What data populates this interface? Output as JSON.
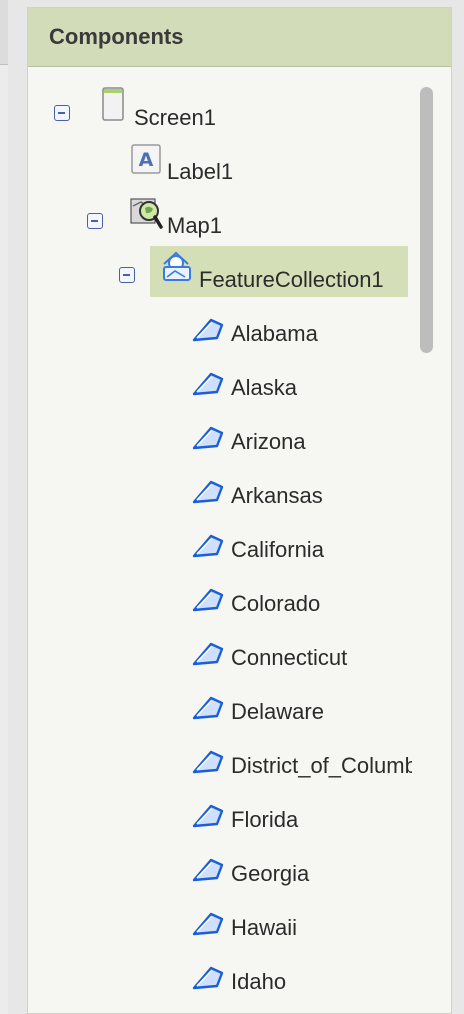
{
  "panel": {
    "title": "Components"
  },
  "tree": {
    "screen": {
      "label": "Screen1",
      "icon": "screen-icon"
    },
    "label_component": {
      "label": "Label1",
      "icon": "label-icon"
    },
    "map": {
      "label": "Map1",
      "icon": "map-icon"
    },
    "feature_collection": {
      "label": "FeatureCollection1",
      "icon": "feature-collection-icon"
    },
    "features": [
      {
        "label": "Alabama",
        "icon": "polygon-icon"
      },
      {
        "label": "Alaska",
        "icon": "polygon-icon"
      },
      {
        "label": "Arizona",
        "icon": "polygon-icon"
      },
      {
        "label": "Arkansas",
        "icon": "polygon-icon"
      },
      {
        "label": "California",
        "icon": "polygon-icon"
      },
      {
        "label": "Colorado",
        "icon": "polygon-icon"
      },
      {
        "label": "Connecticut",
        "icon": "polygon-icon"
      },
      {
        "label": "Delaware",
        "icon": "polygon-icon"
      },
      {
        "label": "District_of_Columbia",
        "icon": "polygon-icon"
      },
      {
        "label": "Florida",
        "icon": "polygon-icon"
      },
      {
        "label": "Georgia",
        "icon": "polygon-icon"
      },
      {
        "label": "Hawaii",
        "icon": "polygon-icon"
      },
      {
        "label": "Idaho",
        "icon": "polygon-icon"
      }
    ]
  },
  "colors": {
    "header_bg": "#d2dcb9",
    "selected_bg": "#d4dfb7",
    "toggle_border": "#4a5fa6",
    "polygon_stroke": "#1a5fd6"
  }
}
